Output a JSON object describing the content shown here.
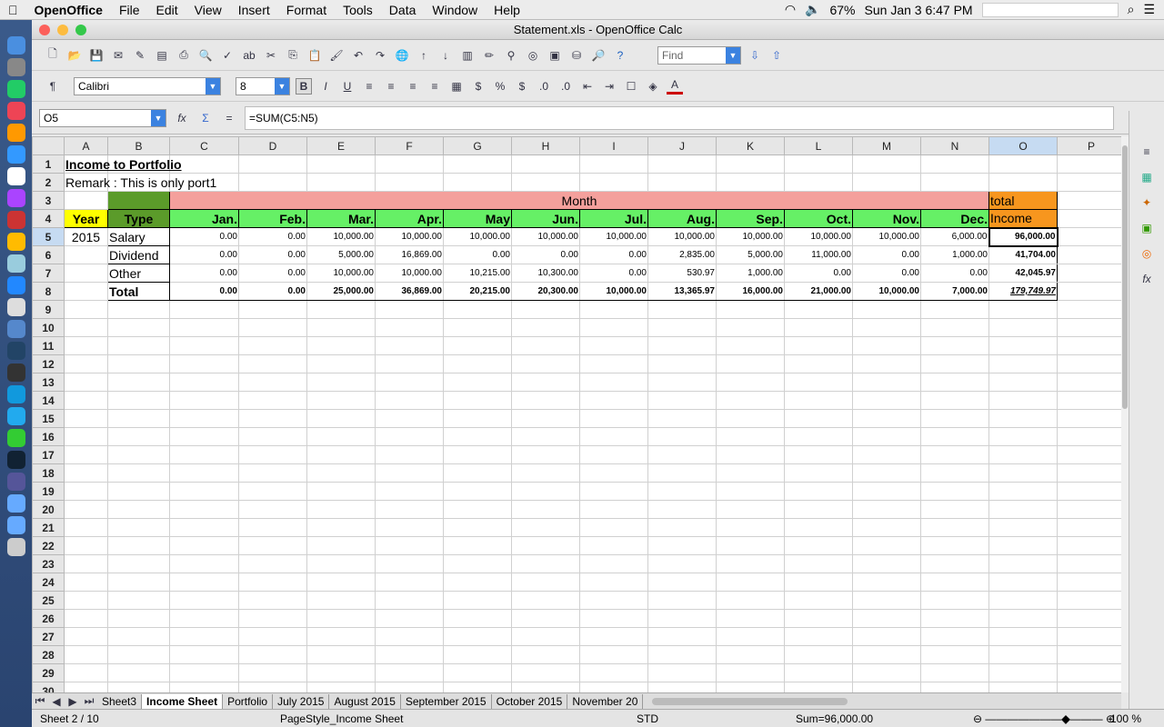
{
  "menubar": {
    "apple": "",
    "app": "OpenOffice",
    "items": [
      "File",
      "Edit",
      "View",
      "Insert",
      "Format",
      "Tools",
      "Data",
      "Window",
      "Help"
    ],
    "battery": "67%",
    "datetime": "Sun Jan 3  6:47 PM"
  },
  "window": {
    "title": "Statement.xls - OpenOffice Calc"
  },
  "toolbar": {
    "find_placeholder": "Find",
    "font_name": "Calibri",
    "font_size": "8"
  },
  "formula": {
    "cell_ref": "O5",
    "content": "=SUM(C5:N5)"
  },
  "columns": [
    "A",
    "B",
    "C",
    "D",
    "E",
    "F",
    "G",
    "H",
    "I",
    "J",
    "K",
    "L",
    "M",
    "N",
    "O",
    "P"
  ],
  "active_col": "O",
  "active_row": 5,
  "cells": {
    "title": "Income to Portfolio",
    "remark": "Remark : This is only port1",
    "month": "Month",
    "total": "total",
    "income": "Income",
    "year": "Year",
    "type": "Type",
    "months": [
      "Jan.",
      "Feb.",
      "Mar.",
      "Apr.",
      "May",
      "Jun.",
      "Jul.",
      "Aug.",
      "Sep.",
      "Oct.",
      "Nov.",
      "Dec."
    ],
    "year_value": "2015",
    "rows": [
      {
        "type": "Salary",
        "values": [
          "0.00",
          "0.00",
          "10,000.00",
          "10,000.00",
          "10,000.00",
          "10,000.00",
          "10,000.00",
          "10,000.00",
          "10,000.00",
          "10,000.00",
          "10,000.00",
          "6,000.00"
        ],
        "total": "96,000.00"
      },
      {
        "type": "Dividend",
        "values": [
          "0.00",
          "0.00",
          "5,000.00",
          "16,869.00",
          "0.00",
          "0.00",
          "0.00",
          "2,835.00",
          "5,000.00",
          "11,000.00",
          "0.00",
          "1,000.00"
        ],
        "total": "41,704.00"
      },
      {
        "type": "Other",
        "values": [
          "0.00",
          "0.00",
          "10,000.00",
          "10,000.00",
          "10,215.00",
          "10,300.00",
          "0.00",
          "530.97",
          "1,000.00",
          "0.00",
          "0.00",
          "0.00"
        ],
        "total": "42,045.97"
      },
      {
        "type": "Total",
        "values": [
          "0.00",
          "0.00",
          "25,000.00",
          "36,869.00",
          "20,215.00",
          "20,300.00",
          "10,000.00",
          "13,365.97",
          "16,000.00",
          "21,000.00",
          "10,000.00",
          "7,000.00"
        ],
        "total": "179,749.97"
      }
    ]
  },
  "colors": {
    "yellow": "#ffff00",
    "green_dark": "#5b9b2a",
    "pink": "#f4a09c",
    "green_light": "#66f066",
    "orange": "#f7961e"
  },
  "sheet_tabs": [
    "Sheet3",
    "Income Sheet",
    "Portfolio",
    "July 2015",
    "August 2015",
    "September 2015",
    "October 2015",
    "November 20"
  ],
  "active_tab": "Income Sheet",
  "status": {
    "sheet": "Sheet 2 / 10",
    "page_style": "PageStyle_Income Sheet",
    "mode": "STD",
    "sum": "Sum=96,000.00",
    "zoom": "100 %"
  }
}
